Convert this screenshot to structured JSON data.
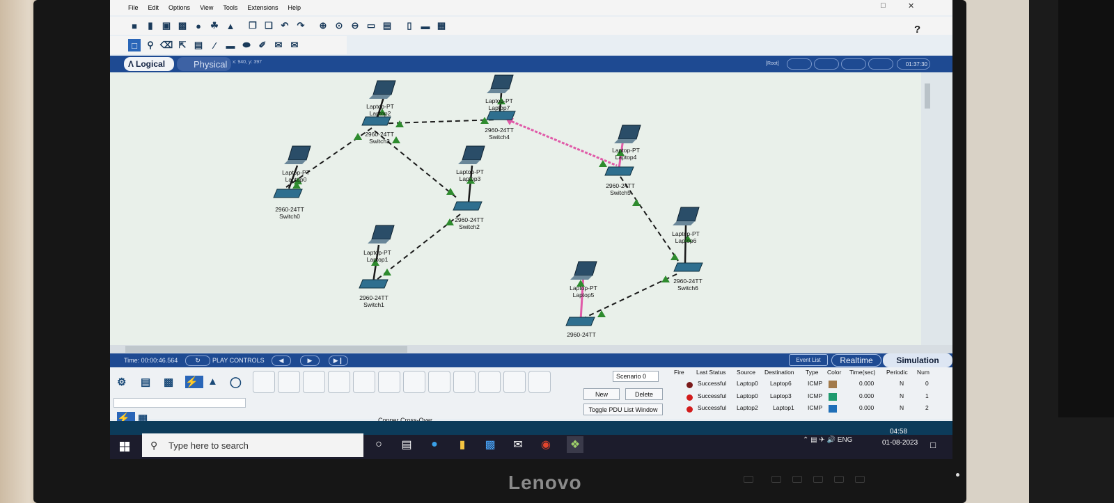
{
  "menu": [
    "File",
    "Edit",
    "Options",
    "View",
    "Tools",
    "Extensions",
    "Help"
  ],
  "help_label": "?",
  "tabs": {
    "logical": "Logical",
    "physical": "Physical",
    "coords": "x: 940, y: 397",
    "root": "[Root]",
    "clock": "01:37:30"
  },
  "devices": [
    {
      "model": "Laptop-PT",
      "name": "Laptop2"
    },
    {
      "model": "Laptop-PT",
      "name": "Laptop7"
    },
    {
      "model": "Laptop-PT",
      "name": "Laptop4"
    },
    {
      "model": "Laptop-PT",
      "name": "Laptop0"
    },
    {
      "model": "Laptop-PT",
      "name": "Laptop3"
    },
    {
      "model": "Laptop-PT",
      "name": "Laptop6"
    },
    {
      "model": "Laptop-PT",
      "name": "Laptop1"
    },
    {
      "model": "Laptop-PT",
      "name": "Laptop5"
    }
  ],
  "switches": [
    {
      "model": "2960-24TT",
      "name": "Switch3"
    },
    {
      "model": "2960-24TT",
      "name": "Switch4"
    },
    {
      "model": "2960-24TT",
      "name": "Switch5"
    },
    {
      "model": "2960-24TT",
      "name": "Switch0"
    },
    {
      "model": "2960-24TT",
      "name": "Switch2"
    },
    {
      "model": "2960-24TT",
      "name": "Switch6"
    },
    {
      "model": "2960-24TT",
      "name": "Switch1"
    },
    {
      "model": "2960-24TT",
      "name": ""
    }
  ],
  "simbar": {
    "time": "Time: 00:00:46.564",
    "play_controls": "PLAY CONTROLS",
    "event_list": "Event List",
    "realtime": "Realtime",
    "simulation": "Simulation"
  },
  "bottom": {
    "connection_caption": "Copper Cross-Over",
    "scenario": "Scenario 0",
    "new_label": "New",
    "delete_label": "Delete",
    "toggle_label": "Toggle PDU List Window"
  },
  "pdu": {
    "headers": [
      "Fire",
      "Last Status",
      "Source",
      "Destination",
      "Type",
      "Color",
      "Time(sec)",
      "Periodic",
      "Num"
    ],
    "rows": [
      {
        "status": "Successful",
        "source": "Laptop0",
        "destination": "Laptop6",
        "type": "ICMP",
        "color": "#a27a4a",
        "time": "0.000",
        "periodic": "N",
        "num": "0"
      },
      {
        "status": "Successful",
        "source": "Laptop0",
        "destination": "Laptop3",
        "type": "ICMP",
        "color": "#1f9a6e",
        "time": "0.000",
        "periodic": "N",
        "num": "1"
      },
      {
        "status": "Successful",
        "source": "Laptop2",
        "destination": "Laptop1",
        "type": "ICMP",
        "color": "#1f6fb8",
        "time": "0.000",
        "periodic": "N",
        "num": "2"
      }
    ]
  },
  "taskbar": {
    "search_placeholder": "Type here to search",
    "lang": "ENG",
    "time": "04:58",
    "date": "01-08-2023"
  },
  "brand": "Lenovo",
  "colors": {
    "accent": "#1e4a92",
    "link_ok": "#2e8b2e",
    "link_pink": "#e05aa8"
  }
}
